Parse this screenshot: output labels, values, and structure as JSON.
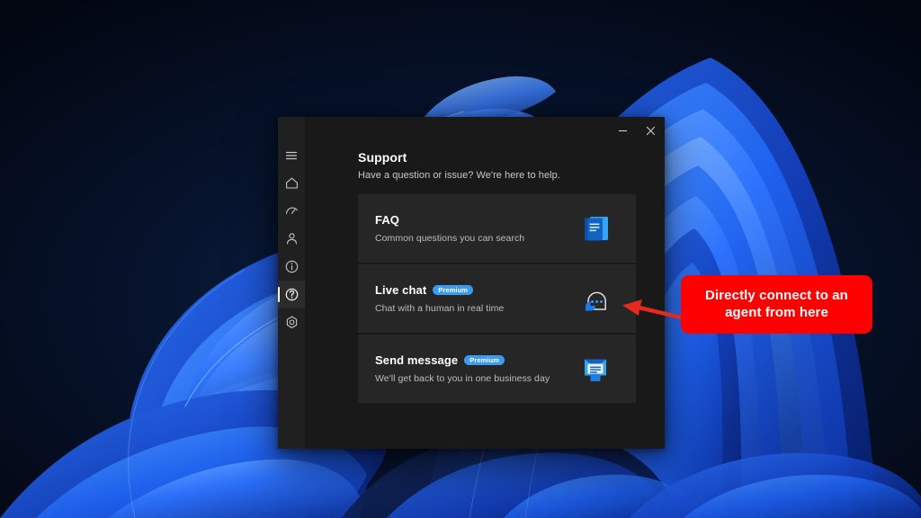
{
  "window": {
    "page_title": "Support",
    "page_subtitle": "Have a question or issue? We're here to help.",
    "caption_buttons": [
      {
        "name": "minimize",
        "label": "Minimize"
      },
      {
        "name": "close",
        "label": "Close"
      }
    ]
  },
  "nav_rail": {
    "items": [
      {
        "icon": "hamburger-menu-icon",
        "label": "Menu",
        "selected": false
      },
      {
        "icon": "home-icon",
        "label": "Home",
        "selected": false
      },
      {
        "icon": "gauge-icon",
        "label": "Performance",
        "selected": false
      },
      {
        "icon": "person-icon",
        "label": "Account",
        "selected": false
      },
      {
        "icon": "info-circle-icon",
        "label": "About",
        "selected": false
      },
      {
        "icon": "question-circle-icon",
        "label": "Support",
        "selected": true
      },
      {
        "icon": "settings-hexagon-icon",
        "label": "Settings",
        "selected": false
      }
    ]
  },
  "cards": [
    {
      "title": "FAQ",
      "badge": "",
      "description": "Common questions you can search",
      "icon": "book-icon"
    },
    {
      "title": "Live chat",
      "badge": "Premium",
      "description": "Chat with a human in real time",
      "icon": "chat-bubble-icon"
    },
    {
      "title": "Send message",
      "badge": "Premium",
      "description": "We'll get back to you in one business day",
      "icon": "envelope-icon"
    }
  ],
  "annotation": {
    "text": "Directly connect to an agent from here",
    "box_color": "#fe0000",
    "text_color": "#ffffff",
    "arrow_color": "#e8291e"
  },
  "colors": {
    "accent_blue": "#3a9bf0",
    "window_bg": "#191919",
    "rail_bg": "#202020",
    "card_bg": "#262626",
    "desktop_bg": "#030a1a"
  }
}
